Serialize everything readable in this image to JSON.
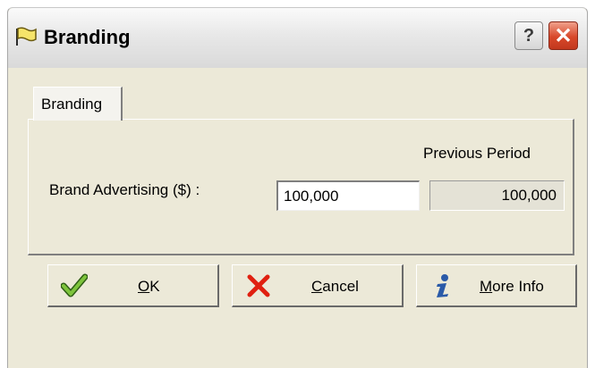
{
  "window": {
    "title": "Branding",
    "help_glyph": "?",
    "close_glyph": "✕",
    "icon": "folder-flag-icon"
  },
  "tabs": [
    {
      "label": "Branding",
      "active": true
    }
  ],
  "form": {
    "previous_period_label": "Previous Period",
    "brand_advertising_label": "Brand Advertising ($) :",
    "brand_advertising_value": "100,000",
    "previous_value": "100,000"
  },
  "buttons": {
    "ok": {
      "mnemonic": "O",
      "rest": "K",
      "icon": "check-icon"
    },
    "cancel": {
      "mnemonic": "C",
      "rest": "ancel",
      "icon": "x-icon"
    },
    "more_info": {
      "mnemonic": "M",
      "rest": "ore Info",
      "icon": "info-icon"
    }
  },
  "colors": {
    "dialog_bg": "#ece9d8",
    "close_red": "#d8482a",
    "check_green": "#5aa02c",
    "x_red": "#e02010",
    "info_blue": "#2a5aa8"
  }
}
